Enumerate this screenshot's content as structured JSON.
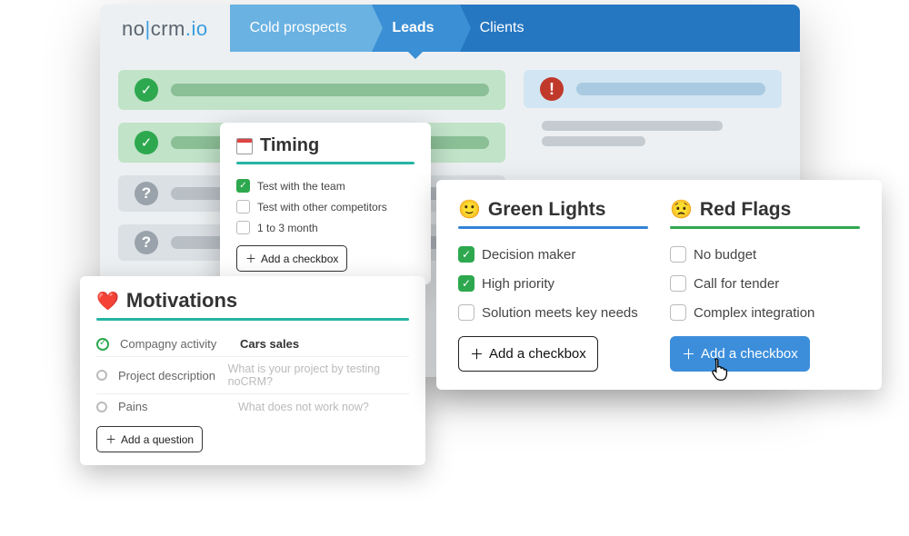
{
  "logo": {
    "no": "no",
    "crm": "crm",
    "io": ".io"
  },
  "tabs": {
    "cold": "Cold prospects",
    "leads": "Leads",
    "clients": "Clients"
  },
  "timing": {
    "title": "Timing",
    "items": [
      "Test with the team",
      "Test with other competitors",
      "1 to 3 month"
    ],
    "add": "Add a checkbox"
  },
  "motivations": {
    "title": "Motivations",
    "rows": [
      {
        "label": "Compagny activity",
        "value": "Cars sales"
      },
      {
        "label": "Project description",
        "placeholder": "What is your project by testing noCRM?"
      },
      {
        "label": "Pains",
        "placeholder": "What does not work now?"
      }
    ],
    "add": "Add a question"
  },
  "green": {
    "title": "Green Lights",
    "items": [
      "Decision maker",
      "High priority",
      "Solution meets key needs"
    ],
    "add": "Add a checkbox"
  },
  "red": {
    "title": "Red Flags",
    "items": [
      "No budget",
      "Call for tender",
      "Complex integration"
    ],
    "add": "Add a checkbox"
  }
}
